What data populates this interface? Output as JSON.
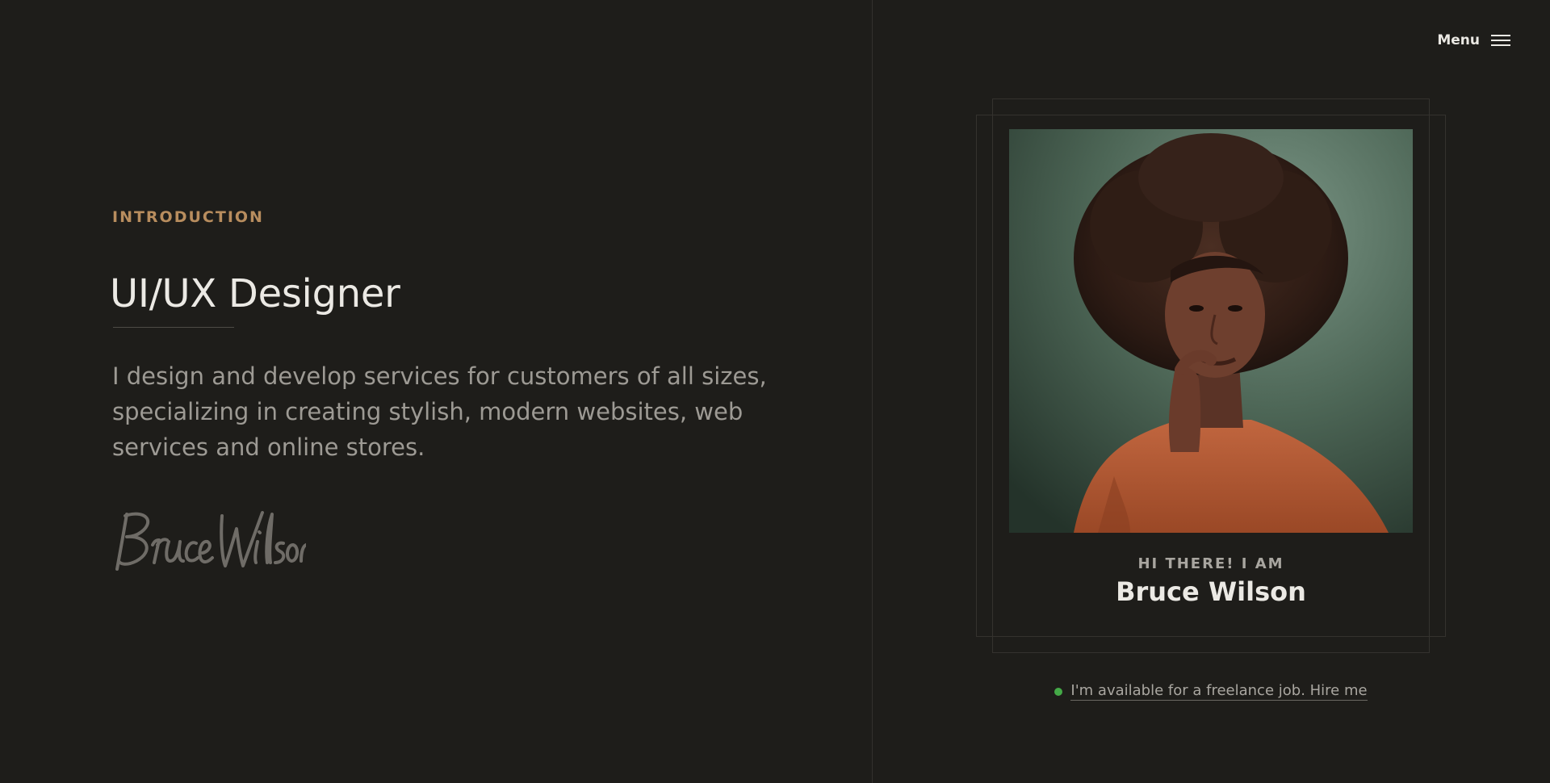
{
  "menu": {
    "label": "Menu",
    "icon": "hamburger-icon"
  },
  "intro": {
    "eyebrow": "INTRODUCTION",
    "title": "UI/UX Designer",
    "bio": "I design and develop services for customers of all sizes, specializing in creating stylish, modern websites, web services and online stores.",
    "signature": "Bruce Wilson"
  },
  "card": {
    "greeting": "HI THERE! I AM",
    "name": "Bruce Wilson",
    "photo_alt": "portrait"
  },
  "availability": {
    "text": "I'm available for a freelance job. Hire me",
    "status_color": "#44a947"
  },
  "colors": {
    "background": "#1e1d1a",
    "accent": "#b88d5e",
    "text": "#ebe9e4",
    "muted": "#9d9a94"
  }
}
